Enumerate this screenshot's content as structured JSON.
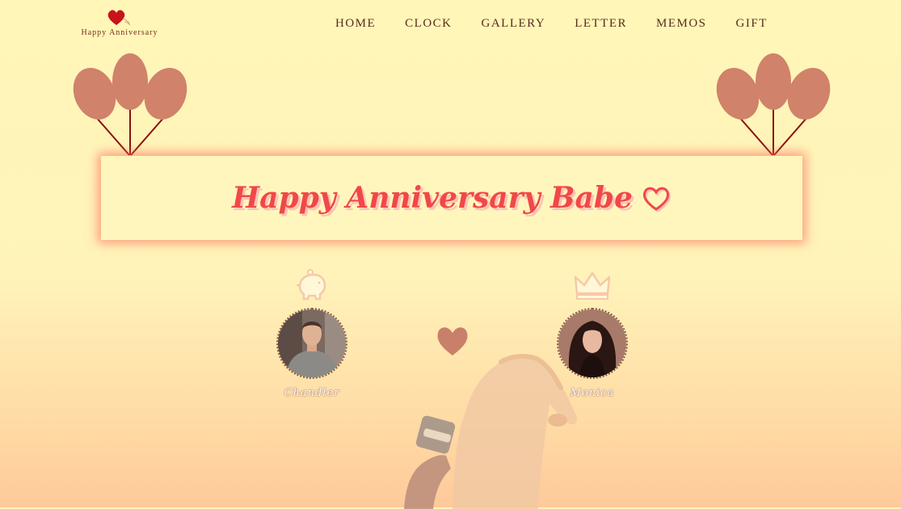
{
  "header": {
    "logo_text": "Happy Anniversary",
    "nav": [
      "HOME",
      "CLOCK",
      "GALLERY",
      "LETTER",
      "MEMOS",
      "GIFT"
    ]
  },
  "banner": {
    "title": "Happy Anniversary Babe"
  },
  "profiles": [
    {
      "name": "Chandler",
      "badge": "piggy-bank-icon"
    },
    {
      "name": "Monica",
      "badge": "crown-icon"
    }
  ],
  "colors": {
    "background_top": "#fff6b8",
    "background_bottom": "#ffc99b",
    "balloon": "#d0826a",
    "banner_text": "#f04848",
    "nav_text": "#5a2a1c"
  }
}
